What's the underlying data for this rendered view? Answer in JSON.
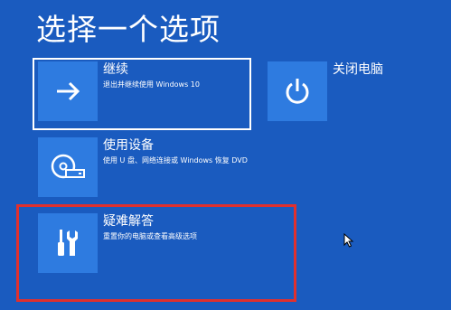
{
  "page": {
    "title": "选择一个选项"
  },
  "options": {
    "continue": {
      "label": "继续",
      "description": "退出并继续使用 Windows 10",
      "icon": "arrow-right-icon"
    },
    "shutdown": {
      "label": "关闭电脑",
      "icon": "power-icon"
    },
    "use_device": {
      "label": "使用设备",
      "description": "使用 U 盘、网络连接或 Windows 恢复 DVD",
      "icon": "disc-drive-icon"
    },
    "troubleshoot": {
      "label": "疑难解答",
      "description": "重置你的电脑或查看高级选项",
      "icon": "tools-icon"
    }
  },
  "colors": {
    "background": "#1a5bbf",
    "tile": "#2e7be0",
    "focus_border": "#ffffff",
    "highlight_border": "#e0302e"
  }
}
